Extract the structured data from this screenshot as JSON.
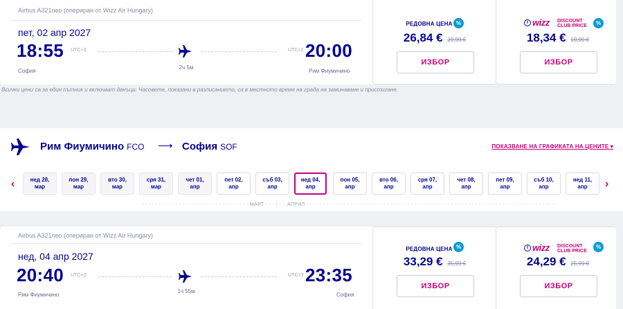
{
  "top_flight": {
    "aircraft": "Airbus A321neo (опериран от Wizz Air Hungary)",
    "date": "пет, 02 апр 2027",
    "dep_time": "18:55",
    "dep_utc": "UTC+3",
    "arr_time": "20:00",
    "arr_utc": "UTC+2",
    "duration": "2ч 5м",
    "dep_city": "София",
    "arr_city": "Рим Фиумичино",
    "regular_label": "РЕДОВНА ЦЕНА",
    "regular_price": "26,84 €",
    "regular_old": "29,99 €",
    "wdc_price": "18,34 €",
    "wdc_old": "19,99 €",
    "select_label": "ИЗБОР"
  },
  "disclaimer": "Всички цени са за един пътник и включват данъци. Часовете, показани в разписанието, са в местното време на града на заминаване и пристигане.",
  "route": {
    "from_city": "Рим Фиумичино",
    "from_code": "FCO",
    "arrow": "⟶",
    "to_city": "София",
    "to_code": "SOF",
    "price_chart_link": "ПОКАЗВАНЕ НА ГРАФИКАТА НА ЦЕНИТЕ ▾"
  },
  "dates": [
    {
      "l1": "нед 28,",
      "l2": "мар",
      "state": "past"
    },
    {
      "l1": "пон 29,",
      "l2": "мар",
      "state": "past"
    },
    {
      "l1": "вто 30,",
      "l2": "мар",
      "state": "past"
    },
    {
      "l1": "сря 31,",
      "l2": "мар",
      "state": "past"
    },
    {
      "l1": "чет 01,",
      "l2": "апр",
      "state": "past"
    },
    {
      "l1": "пет 02,",
      "l2": "апр",
      "state": "avail"
    },
    {
      "l1": "съб 03,",
      "l2": "апр",
      "state": "avail"
    },
    {
      "l1": "нед 04,",
      "l2": "апр",
      "state": "sel"
    },
    {
      "l1": "пон 05,",
      "l2": "апр",
      "state": "avail"
    },
    {
      "l1": "вто 06,",
      "l2": "апр",
      "state": "avail"
    },
    {
      "l1": "сря 07,",
      "l2": "апр",
      "state": "avail"
    },
    {
      "l1": "чет 08,",
      "l2": "апр",
      "state": "avail"
    },
    {
      "l1": "пет 09,",
      "l2": "апр",
      "state": "avail"
    },
    {
      "l1": "съб 10,",
      "l2": "апр",
      "state": "avail"
    },
    {
      "l1": "нед 11,",
      "l2": "апр",
      "state": "avail"
    }
  ],
  "months": {
    "march": "МАРТ",
    "april": "АПРИЛ"
  },
  "bottom_flight": {
    "aircraft": "Airbus A321neo (опериран от Wizz Air Hungary)",
    "date": "нед, 04 апр 2027",
    "dep_time": "20:40",
    "dep_utc": "UTC+2",
    "arr_time": "23:35",
    "arr_utc": "UTC+3",
    "duration": "1ч 55м",
    "dep_city": "Рим Фиумичино",
    "arr_city": "София",
    "regular_label": "РЕДОВНА ЦЕНА",
    "regular_price": "33,29 €",
    "regular_old": "35,99 €",
    "wdc_price": "24,29 €",
    "wdc_old": "25,99 €",
    "select_label": "ИЗБОР"
  },
  "wdc": {
    "wizz": "wizz",
    "line1": "DISCOUNT",
    "line2": "CLUB PRICE",
    "info": "i",
    "pct": "%"
  },
  "colors": {
    "navy": "#06038d",
    "magenta": "#c6007e",
    "badge": "#0a9bd6"
  }
}
